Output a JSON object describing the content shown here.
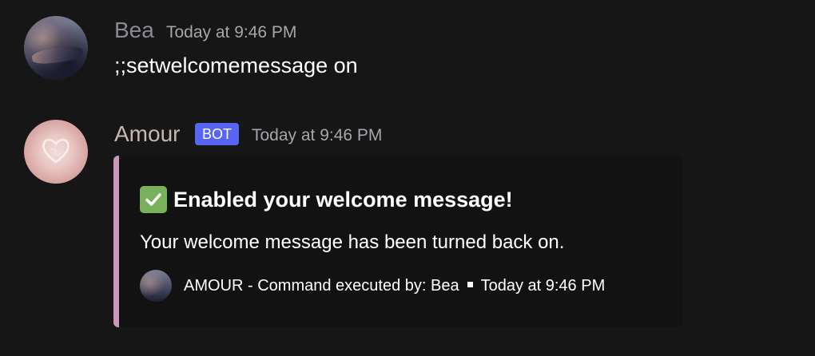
{
  "messages": [
    {
      "author": "Bea",
      "timestamp": "Today at 9:46 PM",
      "content": ";;setwelcomemessage on"
    },
    {
      "author": "Amour",
      "badge": "BOT",
      "timestamp": "Today at 9:46 PM",
      "embed": {
        "accent_color": "#c897b9",
        "title_icon": "white-check-mark-icon",
        "title": "Enabled your welcome message!",
        "description": "Your welcome message has been turned back on.",
        "footer": {
          "icon": "bea-avatar",
          "text": "AMOUR - Command executed by: Bea",
          "timestamp": "Today at 9:46 PM"
        }
      }
    }
  ],
  "colors": {
    "background": "#161616",
    "bot_badge": "#5865f2",
    "embed_background": "#121212",
    "check_green": "#78b159"
  }
}
